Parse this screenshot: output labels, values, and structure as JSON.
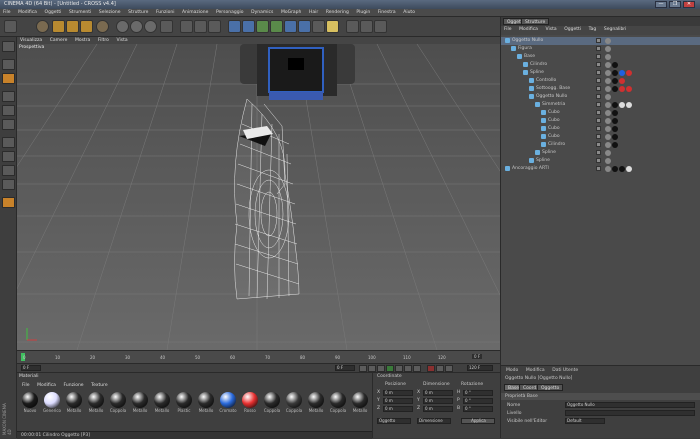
{
  "app": {
    "title": "CINEMA 4D (64 Bit) - [Untitled - CROSS v4.4]",
    "window_buttons": [
      "—",
      "❐",
      "✕"
    ]
  },
  "menubar": [
    "File",
    "Modifica",
    "Oggetti",
    "Strumenti",
    "Selezione",
    "Strutture",
    "Funzioni",
    "Animazione",
    "Personaggio",
    "Dynamics",
    "MoGraph",
    "Hair",
    "Rendering",
    "Plugin",
    "Finestra",
    "Aiuto"
  ],
  "toolbar": {
    "icons": [
      "undo-icon",
      "live-select-icon",
      "move-icon",
      "scale-icon",
      "rotate-icon",
      "last-tool-icon",
      "x-axis-icon",
      "y-axis-icon",
      "z-axis-icon",
      "coord-system-icon",
      "render-view-icon",
      "render-picture-icon",
      "render-settings-icon",
      "cube-icon",
      "spline-pen-icon",
      "subdivision-icon",
      "array-icon",
      "deformer-icon",
      "floor-icon",
      "camera-icon",
      "light-icon",
      "tag-icon",
      "make-editable-icon",
      "layout-icon"
    ]
  },
  "viewport": {
    "menu": [
      "Visualizza",
      "Camere",
      "Mostra",
      "Filtro",
      "Vista"
    ],
    "label": "Prospettiva"
  },
  "timeline": {
    "ticks": [
      "0",
      "10",
      "20",
      "30",
      "40",
      "50",
      "60",
      "70",
      "80",
      "90",
      "100",
      "110",
      "120"
    ],
    "end_label": "0 F",
    "current_frame": "0 F",
    "start_field": "0 F",
    "end_field": "120 F"
  },
  "materials": {
    "title": "Materiali",
    "menu": [
      "File",
      "Modifica",
      "Funzione",
      "Texture"
    ],
    "row1": [
      {
        "name": "Nuovo",
        "color": "#1a1a1a"
      },
      {
        "name": "Generico",
        "color": "#dcdcff"
      },
      {
        "name": "Metallo",
        "color": "#2a2a2a"
      },
      {
        "name": "Metallo",
        "color": "#2a2a2a"
      },
      {
        "name": "Coppola",
        "color": "#2a2a2a"
      },
      {
        "name": "Metallo",
        "color": "#2a2a2a"
      },
      {
        "name": "Metallo",
        "color": "#2a2a2a"
      },
      {
        "name": "Plastic",
        "color": "#2a2a2a"
      },
      {
        "name": "Metallo",
        "color": "#2a2a2a"
      },
      {
        "name": "Cromato",
        "color": "#2a6adc"
      },
      {
        "name": "Rosso",
        "color": "#e83030"
      },
      {
        "name": "Coppola",
        "color": "#2a2a2a"
      },
      {
        "name": "Coppola",
        "color": "#3a3a3a"
      },
      {
        "name": "Metallo",
        "color": "#2a2a2a"
      },
      {
        "name": "Coppola",
        "color": "#2a2a2a"
      },
      {
        "name": "Metallo",
        "color": "#2a2a2a"
      }
    ],
    "status": "00:00:01  Cilindro Oggetto [P3]"
  },
  "coordinates": {
    "title": "Coordinate",
    "headers": [
      "Posizione",
      "Dimensione",
      "Rotazione"
    ],
    "rows": [
      {
        "axis": "X",
        "pos": "0 m",
        "dim": "0 m",
        "rot_axis": "H",
        "rot": "0 °"
      },
      {
        "axis": "Y",
        "pos": "0 m",
        "dim": "0 m",
        "rot_axis": "P",
        "rot": "0 °"
      },
      {
        "axis": "Z",
        "pos": "0 m",
        "dim": "0 m",
        "rot_axis": "B",
        "rot": "0 °"
      }
    ],
    "mode_select": "Oggetto",
    "size_select": "Dimensione",
    "apply_label": "Applica"
  },
  "object_manager": {
    "tabs": [
      "Oggetti",
      "Strutture"
    ],
    "menu": [
      "File",
      "Modifica",
      "Vista",
      "Oggetti",
      "Tag",
      "Segnalibri"
    ],
    "objects": [
      {
        "name": "Oggetto Nullo",
        "indent": 0,
        "tags": [
          "#888888"
        ]
      },
      {
        "name": "Figura",
        "indent": 1,
        "tags": [
          "#888888"
        ]
      },
      {
        "name": "Base",
        "indent": 2,
        "tags": [
          "#888888"
        ]
      },
      {
        "name": "Cilindro",
        "indent": 3,
        "tags": [
          "#888888",
          "#111111"
        ]
      },
      {
        "name": "Spline",
        "indent": 3,
        "tags": [
          "#888888",
          "#111111",
          "#2060e0",
          "#d03030"
        ]
      },
      {
        "name": "Controllo",
        "indent": 4,
        "tags": [
          "#888888",
          "#111111",
          "#d03030"
        ]
      },
      {
        "name": "Sottoogg. Base",
        "indent": 4,
        "tags": [
          "#888888",
          "#111111",
          "#d03030",
          "#d03030"
        ]
      },
      {
        "name": "Oggetto Nullo",
        "indent": 4,
        "tags": [
          "#888888"
        ]
      },
      {
        "name": "Simmetria",
        "indent": 5,
        "tags": [
          "#888888",
          "#111111",
          "#dddddd",
          "#dddddd"
        ]
      },
      {
        "name": "Cubo",
        "indent": 6,
        "tags": [
          "#888888",
          "#111111"
        ]
      },
      {
        "name": "Cubo",
        "indent": 6,
        "tags": [
          "#888888",
          "#111111"
        ]
      },
      {
        "name": "Cubo",
        "indent": 6,
        "tags": [
          "#888888",
          "#111111"
        ]
      },
      {
        "name": "Cubo",
        "indent": 6,
        "tags": [
          "#888888",
          "#111111"
        ]
      },
      {
        "name": "Cilindro",
        "indent": 6,
        "tags": [
          "#888888",
          "#111111"
        ]
      },
      {
        "name": "Spline",
        "indent": 5,
        "tags": [
          "#888888"
        ]
      },
      {
        "name": "Spline",
        "indent": 4,
        "tags": [
          "#888888"
        ]
      },
      {
        "name": "Ancoraggio ARTI",
        "indent": 0,
        "tags": [
          "#888888",
          "#111111",
          "#111111",
          "#dddddd"
        ]
      }
    ]
  },
  "attributes": {
    "menu": [
      "Modo",
      "Modifica",
      "Dati Utente"
    ],
    "header": "Oggetto Nullo [Oggetto Nullo]",
    "tabs": [
      "Base",
      "Coord.",
      "Oggetto"
    ],
    "section": "Proprietà Base",
    "fields": [
      {
        "label": "Nome",
        "value": "Oggetto Nullo"
      },
      {
        "label": "Livello",
        "value": ""
      },
      {
        "label": "Visibile nell'Editor",
        "value": "Default"
      }
    ]
  },
  "vertical_label": "MAXON CINEMA 4D"
}
